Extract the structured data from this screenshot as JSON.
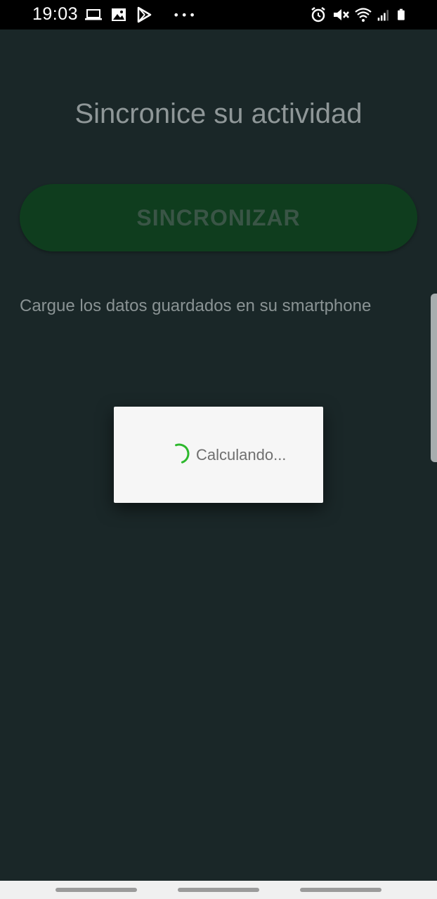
{
  "status_bar": {
    "time": "19:03",
    "left_icons": [
      "laptop-icon",
      "image-icon",
      "play-store-icon",
      "more-dots-icon"
    ],
    "right_icons": [
      "alarm-icon",
      "mute-icon",
      "wifi-icon",
      "signal-icon",
      "battery-icon"
    ],
    "more_label": "•••"
  },
  "screen": {
    "title": "Sincronice su actividad",
    "sync_button_label": "SINCRONIZAR",
    "subtitle": "Cargue los datos guardados en su smartphone"
  },
  "dialog": {
    "message": "Calculando..."
  },
  "colors": {
    "background": "#1a2728",
    "button": "#0f3d1e",
    "spinner": "#2db82d",
    "dialog": "#f6f6f6"
  }
}
